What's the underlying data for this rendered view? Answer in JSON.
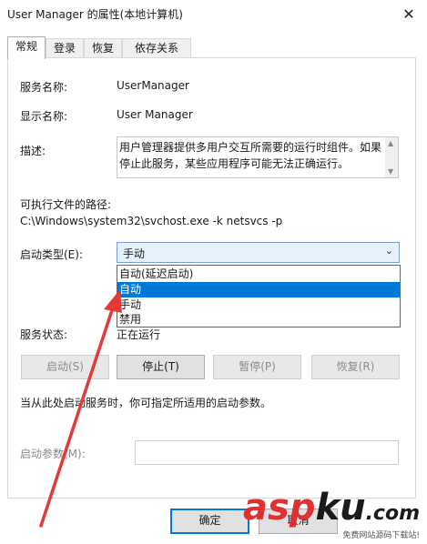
{
  "window": {
    "title": "User Manager 的属性(本地计算机)",
    "close_icon": "✕"
  },
  "tabs": [
    "常规",
    "登录",
    "恢复",
    "依存关系"
  ],
  "general": {
    "service_name_label": "服务名称:",
    "service_name_value": "UserManager",
    "display_name_label": "显示名称:",
    "display_name_value": "User Manager",
    "description_label": "描述:",
    "description_value": "用户管理器提供多用户交互所需要的运行时组件。如果停止此服务，某些应用程序可能无法正确运行。",
    "path_label": "可执行文件的路径:",
    "path_value": "C:\\Windows\\system32\\svchost.exe -k netsvcs -p",
    "startup_type_label": "启动类型(E):",
    "startup_type_value": "手动",
    "startup_options": [
      "自动(延迟启动)",
      "自动",
      "手动",
      "禁用"
    ],
    "startup_selected_index": 1,
    "status_label": "服务状态:",
    "status_value": "正在运行",
    "buttons": {
      "start": "启动(S)",
      "stop": "停止(T)",
      "pause": "暂停(P)",
      "resume": "恢复(R)"
    },
    "hint": "当从此处启动服务时，你可指定所适用的启动参数。",
    "param_label": "启动参数(M):",
    "param_value": ""
  },
  "footer": {
    "ok": "确定",
    "cancel": "取消"
  },
  "watermark": {
    "logo_a": "asp",
    "logo_b": "ku",
    "logo_c": ".com",
    "tagline": "免费网站源码下载站!"
  },
  "colors": {
    "accent": "#0078d7",
    "arrow": "#e53935"
  }
}
